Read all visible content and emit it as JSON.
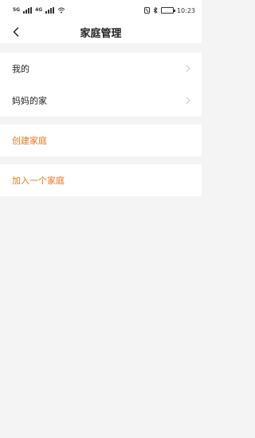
{
  "status_bar": {
    "sim1": "5G",
    "sim2": "4G",
    "battery": "",
    "time": "10:23"
  },
  "header": {
    "title": "家庭管理"
  },
  "families": [
    {
      "label": "我的"
    },
    {
      "label": "妈妈的家"
    }
  ],
  "actions": {
    "create": "创建家庭",
    "join": "加入一个家庭"
  },
  "colors": {
    "accent": "#e6761f",
    "background": "#f4f4f4"
  }
}
